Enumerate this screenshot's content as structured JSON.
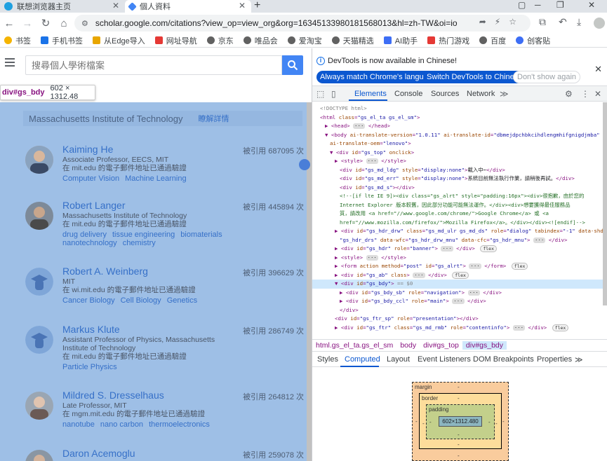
{
  "tabs": [
    {
      "title": "联想浏览器主页",
      "active": false,
      "icon_color": "#1fa0e0"
    },
    {
      "title": "個人資料",
      "active": true,
      "icon_color": "#4285f4"
    }
  ],
  "omnibox": {
    "url": "scholar.google.com/citations?view_op=view_org&org=16345133980181568013&hl=zh-TW&oi=io"
  },
  "bookmarks": [
    {
      "label": "书签",
      "color": "#f5b400"
    },
    {
      "label": "手机书签",
      "color": "#1a73e8"
    },
    {
      "label": "从Edge导入",
      "color": "#e8a600"
    },
    {
      "label": "网址导航",
      "color": "#e53935"
    },
    {
      "label": "京东",
      "color": "#616161"
    },
    {
      "label": "唯品会",
      "color": "#616161"
    },
    {
      "label": "爱淘宝",
      "color": "#616161"
    },
    {
      "label": "天猫精选",
      "color": "#616161"
    },
    {
      "label": "AI助手",
      "color": "#3d6ef5"
    },
    {
      "label": "热门游戏",
      "color": "#e53935"
    },
    {
      "label": "百度",
      "color": "#616161"
    },
    {
      "label": "创客贴",
      "color": "#3d6ef5"
    }
  ],
  "search": {
    "placeholder": "搜尋個人學術檔案"
  },
  "tooltip": {
    "selector": "div#gs_bdy",
    "size": "602 × 1312.48"
  },
  "org": {
    "name": "Massachusetts Institute of Technology",
    "learn_more": "瞭解詳情"
  },
  "authors": [
    {
      "name": "Kaiming He",
      "cited": "被引用 687095 次",
      "affiliation": "Associate Professor, EECS, MIT",
      "email": "在 mit.edu 的電子郵件地址已通過驗證",
      "tags": [
        "Computer Vision",
        "Machine Learning"
      ],
      "avatar": "photo"
    },
    {
      "name": "Robert Langer",
      "cited": "被引用 445894 次",
      "affiliation": "Massachusetts Institute of Technology",
      "email": "在 mit.edu 的電子郵件地址已通過驗證",
      "tags": [
        "drug delivery",
        "tissue engineering",
        "biomaterials",
        "nanotechnology",
        "chemistry"
      ],
      "avatar": "photo"
    },
    {
      "name": "Robert A. Weinberg",
      "cited": "被引用 396629 次",
      "affiliation": "MIT",
      "email": "在 wi.mit.edu 的電子郵件地址已通過驗證",
      "tags": [
        "Cancer Biology",
        "Cell Biology",
        "Genetics"
      ],
      "avatar": "placeholder"
    },
    {
      "name": "Markus Klute",
      "cited": "被引用 286749 次",
      "affiliation": "Assistant Professor of Physics, Massachusetts Institute of Technology",
      "email": "在 mit.edu 的電子郵件地址已通過驗證",
      "tags": [
        "Particle Physics"
      ],
      "avatar": "placeholder"
    },
    {
      "name": "Mildred S. Dresselhaus",
      "cited": "被引用 264812 次",
      "affiliation": "Late Professor, MIT",
      "email": "在 mgm.mit.edu 的電子郵件地址已通過驗證",
      "tags": [
        "nanotube",
        "nano carbon",
        "thermoelectronics"
      ],
      "avatar": "photo"
    },
    {
      "name": "Daron Acemoglu",
      "cited": "被引用 259078 次",
      "affiliation": "",
      "email": "",
      "tags": [],
      "avatar": "photo"
    }
  ],
  "devtools": {
    "info_text": "DevTools is now available in Chinese!",
    "btn_match": "Always match Chrome's language",
    "btn_switch": "Switch DevTools to Chinese",
    "btn_dont": "Don't show again",
    "tabs": [
      "Elements",
      "Console",
      "Sources",
      "Network"
    ],
    "breadcrumbs": [
      "html.gs_el_ta.gs_el_sm",
      "body",
      "div#gs_top",
      "div#gs_bdy"
    ],
    "sub_tabs": [
      "Styles",
      "Computed",
      "Layout",
      "Event Listeners",
      "DOM Breakpoints",
      "Properties"
    ],
    "box_model": {
      "margin": "margin",
      "border": "border",
      "padding": "padding",
      "content": "602×1312.480",
      "dash": "-"
    }
  },
  "dom_lines": [
    {
      "indent": 0,
      "html": "<span class='gray'>&lt;!DOCTYPE html&gt;</span>"
    },
    {
      "indent": 0,
      "html": "&lt;html <span class='attr'>class</span>=<span class='val'>\"gs_el_ta gs_el_sm\"</span>&gt;"
    },
    {
      "indent": 1,
      "html": "▶ &lt;head&gt; <span class='ell'>···</span> &lt;/head&gt;"
    },
    {
      "indent": 1,
      "html": "▼ &lt;body <span class='attr'>ai-translate-version</span>=<span class='val'>\"1.0.11\"</span> <span class='attr'>ai-translate-id</span>=<span class='val'>\"dbmejdpchbkcihdlengmhifgnigdjmba\"</span>"
    },
    {
      "indent": 2,
      "html": "<span class='attr'>ai-translate-oem</span>=<span class='val'>\"lenovo\"</span>&gt;"
    },
    {
      "indent": 2,
      "html": "▼ &lt;div <span class='attr'>id</span>=<span class='val'>\"gs_top\"</span> <span class='attr'>onclick</span>&gt;"
    },
    {
      "indent": 3,
      "html": "▶ &lt;style&gt; <span class='ell'>···</span> &lt;/style&gt;"
    },
    {
      "indent": 4,
      "html": "&lt;div <span class='attr'>id</span>=<span class='val'>\"gs_md_ldg\"</span> <span class='attr'>style</span>=<span class='val'>\"display:none\"</span>&gt;<span class='txt'>載入中⋯</span>&lt;/div&gt;"
    },
    {
      "indent": 4,
      "html": "&lt;div <span class='attr'>id</span>=<span class='val'>\"gs_md_err\"</span> <span class='attr'>style</span>=<span class='val'>\"display:none\"</span>&gt;<span class='txt'>系統目前無法執行作業，請稍後再試。</span>&lt;/div&gt;"
    },
    {
      "indent": 4,
      "html": "&lt;div <span class='attr'>id</span>=<span class='val'>\"gs_md_s\"</span>&gt;&lt;/div&gt;"
    },
    {
      "indent": 4,
      "html": "<span class='cmt'>&lt;!--[if lte IE 9]&gt;&lt;div class=\"gs_alrt\" style=\"padding:16px\"&gt;&lt;div&gt;很抱歉，由於您的</span>"
    },
    {
      "indent": 4,
      "html": "<span class='cmt'>Internet Explorer 版本較舊，因此部分功能可能無法運作。&lt;/div&gt;&lt;div&gt;想要獲得最佳服務品</span>"
    },
    {
      "indent": 4,
      "html": "<span class='cmt'>質，請改用 &lt;a href=\"//www.google.com/chrome/\"&gt;Google Chrome&lt;/a&gt; 或 &lt;a</span>"
    },
    {
      "indent": 4,
      "html": "<span class='cmt'>href=\"//www.mozilla.com/firefox/\"&gt;Mozilla Firefox&lt;/a&gt;。&lt;/div&gt;&lt;/div&gt;&lt;![endif]--&gt;</span>"
    },
    {
      "indent": 3,
      "html": "▶ &lt;div <span class='attr'>id</span>=<span class='val'>\"gs_hdr_drw\"</span> <span class='attr'>class</span>=<span class='val'>\"gs_md_ulr gs_md_ds\"</span> <span class='attr'>role</span>=<span class='val'>\"dialog\"</span> <span class='attr'>tabindex</span>=<span class='val'>\"-1\"</span> <span class='attr'>data-shd</span>="
    },
    {
      "indent": 4,
      "html": "<span class='val'>\"gs_hdr_drs\"</span> <span class='attr'>data-wfc</span>=<span class='val'>\"gs_hdr_drw_mnu\"</span> <span class='attr'>data-cfc</span>=<span class='val'>\"gs_hdr_mnu\"</span>&gt; <span class='ell'>···</span> &lt;/div&gt;"
    },
    {
      "indent": 3,
      "html": "▶ &lt;div <span class='attr'>id</span>=<span class='val'>\"gs_hdr\"</span> <span class='attr'>role</span>=<span class='val'>\"banner\"</span>&gt; <span class='ell'>···</span> &lt;/div&gt; <span class='badge-flex'>flex</span>"
    },
    {
      "indent": 3,
      "html": "▶ &lt;style&gt; <span class='ell'>···</span> &lt;/style&gt;"
    },
    {
      "indent": 3,
      "html": "▶ &lt;form <span class='attr'>action</span> <span class='attr'>method</span>=<span class='val'>\"post\"</span> <span class='attr'>id</span>=<span class='val'>\"gs_alrt\"</span>&gt; <span class='ell'>···</span> &lt;/form&gt; <span class='badge-flex'>flex</span>"
    },
    {
      "indent": 3,
      "html": "▶ &lt;div <span class='attr'>id</span>=<span class='val'>\"gs_ab\"</span> <span class='attr'>class</span>&gt; <span class='ell'>···</span> &lt;/div&gt; <span class='badge-flex'>flex</span>"
    },
    {
      "indent": 3,
      "html": "▼ &lt;div <span class='attr'>id</span>=<span class='val'>\"gs_bdy\"</span>&gt; <span class='gray'>== $0</span>",
      "selected": true
    },
    {
      "indent": 4,
      "html": "▶ &lt;div <span class='attr'>id</span>=<span class='val'>\"gs_bdy_sb\"</span> <span class='attr'>role</span>=<span class='val'>\"navigation\"</span>&gt; <span class='ell'>···</span> &lt;/div&gt;"
    },
    {
      "indent": 4,
      "html": "▶ &lt;div <span class='attr'>id</span>=<span class='val'>\"gs_bdy_ccl\"</span> <span class='attr'>role</span>=<span class='val'>\"main\"</span>&gt; <span class='ell'>···</span> &lt;/div&gt;"
    },
    {
      "indent": 4,
      "html": "&lt;/div&gt;"
    },
    {
      "indent": 3,
      "html": "&lt;div <span class='attr'>id</span>=<span class='val'>\"gs_ftr_sp\"</span> <span class='attr'>role</span>=<span class='val'>\"presentation\"</span>&gt;&lt;/div&gt;"
    },
    {
      "indent": 3,
      "html": "▶ &lt;div <span class='attr'>id</span>=<span class='val'>\"gs_ftr\"</span> <span class='attr'>class</span>=<span class='val'>\"gs_md_rmb\"</span> <span class='attr'>role</span>=<span class='val'>\"contentinfo\"</span>&gt; <span class='ell'>···</span> &lt;/div&gt; <span class='badge-flex'>flex</span>"
    }
  ]
}
